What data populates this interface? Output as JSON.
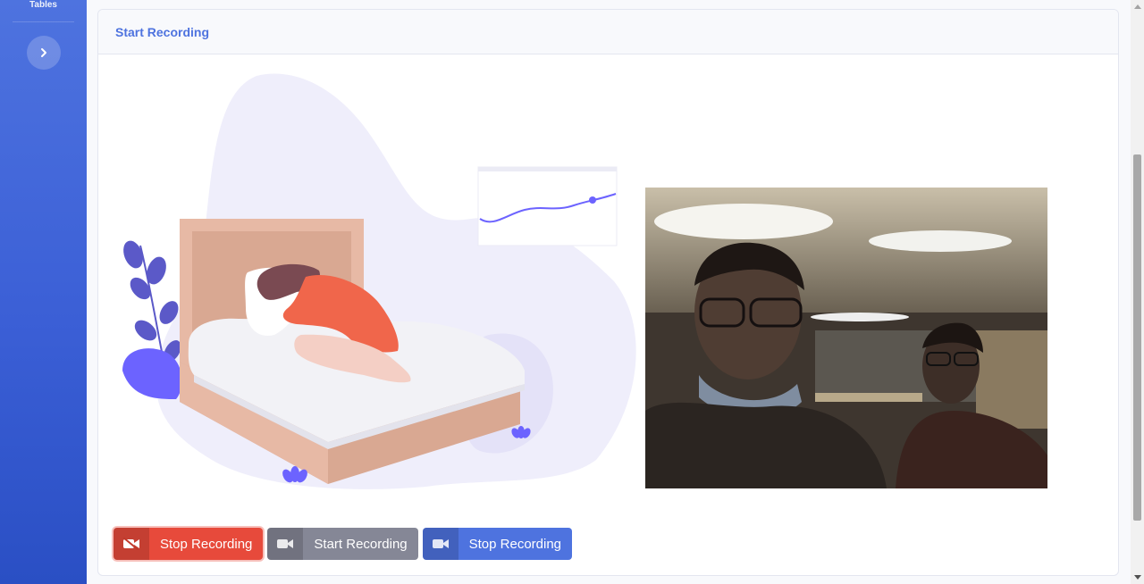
{
  "sidebar": {
    "section_label": "Tables",
    "toggle_icon": "chevron-right-icon"
  },
  "card": {
    "title": "Start Recording"
  },
  "illustration": {
    "subject": "person-sleeping-on-bed",
    "accent_color": "#6c63ff"
  },
  "camera": {
    "subject": "webcam-feed-two-people"
  },
  "buttons": [
    {
      "label": "Stop Recording",
      "icon": "video-off-icon",
      "variant": "danger",
      "color": "#e74a3b"
    },
    {
      "label": "Start Recording",
      "icon": "video-camera-icon",
      "variant": "secondary",
      "color": "#858796"
    },
    {
      "label": "Stop Recording",
      "icon": "video-camera-icon",
      "variant": "primary",
      "color": "#4e73df"
    }
  ]
}
